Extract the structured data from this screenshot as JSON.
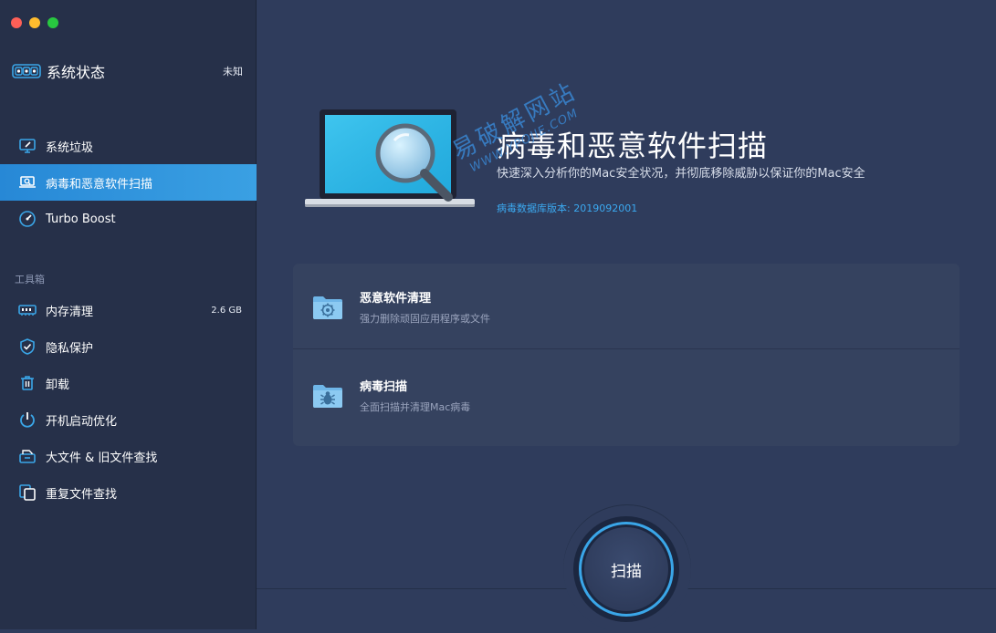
{
  "sidebar": {
    "status": {
      "label": "系统状态",
      "value": "未知"
    },
    "items": [
      {
        "label": "系统垃圾",
        "icon": "monitor-clean-icon",
        "right": ""
      },
      {
        "label": "病毒和恶意软件扫描",
        "icon": "laptop-scan-icon",
        "right": "",
        "active": true
      },
      {
        "label": "Turbo Boost",
        "icon": "speedometer-icon",
        "right": ""
      }
    ],
    "toolbox_title": "工具箱",
    "tools": [
      {
        "label": "内存清理",
        "icon": "memory-icon",
        "right": "2.6 GB"
      },
      {
        "label": "隐私保护",
        "icon": "shield-check-icon",
        "right": ""
      },
      {
        "label": "卸载",
        "icon": "trash-icon",
        "right": ""
      },
      {
        "label": "开机启动优化",
        "icon": "power-icon",
        "right": ""
      },
      {
        "label": "大文件 & 旧文件查找",
        "icon": "file-box-icon",
        "right": ""
      },
      {
        "label": "重复文件查找",
        "icon": "duplicate-files-icon",
        "right": ""
      }
    ]
  },
  "hero": {
    "title": "病毒和恶意软件扫描",
    "subtitle": "快速深入分析你的Mac安全状况，并彻底移除威胁以保证你的Mac安全",
    "db_label": "病毒数据库版本: ",
    "db_version": "2019092001"
  },
  "watermark": {
    "line1": "易破解网站",
    "line2": "WWW.YPOJIE.COM"
  },
  "options": [
    {
      "title": "恶意软件清理",
      "subtitle": "强力删除顽固应用程序或文件",
      "icon": "gear-folder-icon"
    },
    {
      "title": "病毒扫描",
      "subtitle": "全面扫描并清理Mac病毒",
      "icon": "bug-folder-icon"
    }
  ],
  "scan_button": {
    "label": "扫描"
  },
  "colors": {
    "accent": "#2e8fd9",
    "sidebar": "#263049",
    "main": "#2f3c5c",
    "card": "#35425f"
  }
}
